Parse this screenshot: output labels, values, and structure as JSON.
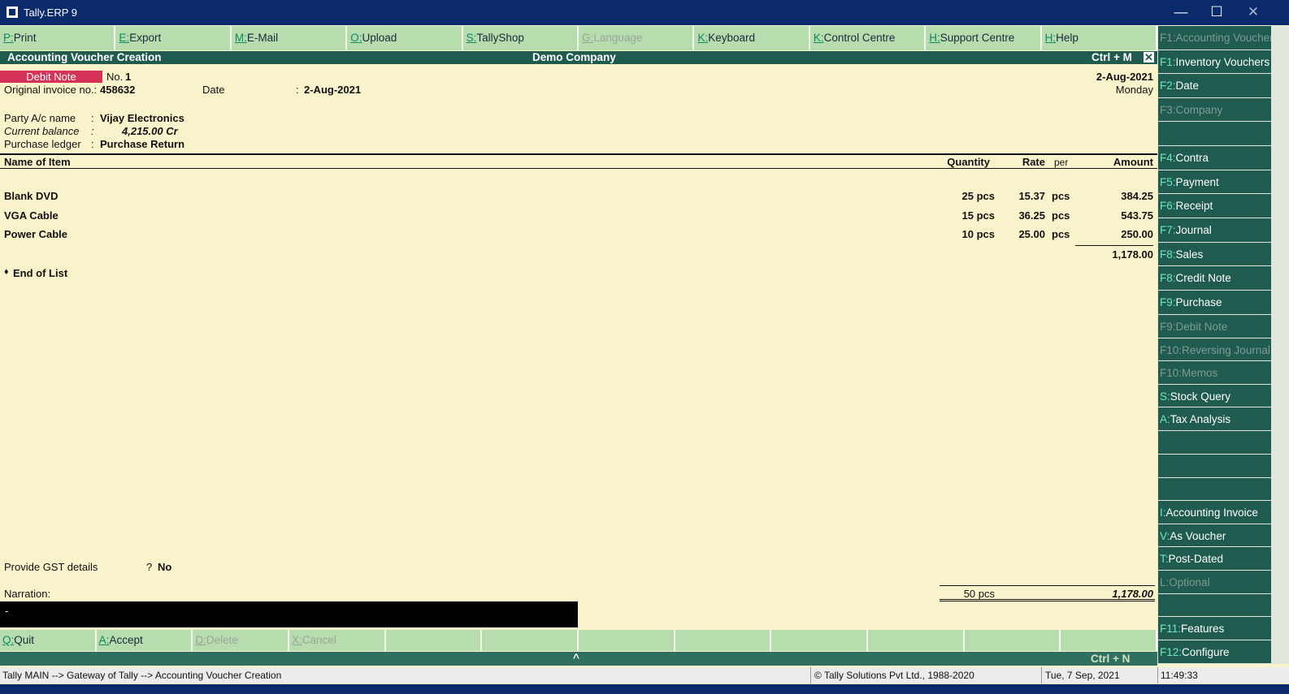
{
  "window": {
    "title": "Tally.ERP 9",
    "minimize": "—",
    "maximize": "☐",
    "close": "✕"
  },
  "toolbar": [
    {
      "key": "P",
      "label": "Print",
      "enabled": true
    },
    {
      "key": "E",
      "label": "Export",
      "enabled": true
    },
    {
      "key": "M",
      "label": "E-Mail",
      "enabled": true
    },
    {
      "key": "O",
      "label": "Upload",
      "enabled": true
    },
    {
      "key": "S",
      "label": "TallyShop",
      "enabled": true
    },
    {
      "key": "G",
      "label": "Language",
      "enabled": false
    },
    {
      "key": "K",
      "label": "Keyboard",
      "enabled": true
    },
    {
      "key": "K",
      "label": "Control Centre",
      "enabled": true
    },
    {
      "key": "H",
      "label": "Support Centre",
      "enabled": true
    },
    {
      "key": "H",
      "label": "Help",
      "enabled": true
    }
  ],
  "header": {
    "title": "Accounting Voucher  Creation",
    "company": "Demo Company",
    "shortcut": "Ctrl + M",
    "close": "✕"
  },
  "voucher": {
    "type": "Debit Note",
    "no_label": "No.",
    "no_value": "1",
    "orig_inv_label": "Original invoice no.:",
    "orig_inv_value": "458632",
    "date_label": "Date",
    "date_colon": ":",
    "date_value": "2-Aug-2021",
    "top_date": "2-Aug-2021",
    "top_day": "Monday",
    "party_label": "Party A/c name",
    "party_value": "Vijay Electronics",
    "balance_label": "Current balance",
    "balance_value": "4,215.00 Cr",
    "ledger_label": "Purchase ledger",
    "ledger_value": "Purchase Return",
    "colon": ":"
  },
  "table": {
    "headers": {
      "name": "Name of Item",
      "quantity": "Quantity",
      "rate": "Rate",
      "per": "per",
      "amount": "Amount"
    },
    "rows": [
      {
        "name": "Blank DVD",
        "quantity": "25 pcs",
        "rate": "15.37",
        "per": "pcs",
        "amount": "384.25"
      },
      {
        "name": "VGA Cable",
        "quantity": "15 pcs",
        "rate": "36.25",
        "per": "pcs",
        "amount": "543.75"
      },
      {
        "name": "Power Cable",
        "quantity": "10 pcs",
        "rate": "25.00",
        "per": "pcs",
        "amount": "250.00"
      }
    ],
    "subtotal": "1,178.00",
    "end_of_list": "End of List",
    "end_marker": "♦"
  },
  "gst": {
    "label": "Provide GST details",
    "q": "?",
    "value": "No"
  },
  "narration": {
    "label": "Narration:",
    "value": "-"
  },
  "totals": {
    "quantity": "50 pcs",
    "amount": "1,178.00"
  },
  "bottom_buttons": [
    {
      "key": "Q",
      "label": "Quit",
      "enabled": true
    },
    {
      "key": "A",
      "label": "Accept",
      "enabled": true
    },
    {
      "key": "D",
      "label": "Delete",
      "enabled": false
    },
    {
      "key": "X",
      "label": "Cancel",
      "enabled": false
    },
    {
      "key": "",
      "label": "",
      "enabled": false
    },
    {
      "key": "",
      "label": "",
      "enabled": false
    },
    {
      "key": "",
      "label": "",
      "enabled": false
    },
    {
      "key": "",
      "label": "",
      "enabled": false
    },
    {
      "key": "",
      "label": "",
      "enabled": false
    },
    {
      "key": "",
      "label": "",
      "enabled": false
    },
    {
      "key": "",
      "label": "",
      "enabled": false
    },
    {
      "key": "",
      "label": "",
      "enabled": false
    }
  ],
  "strip": {
    "caret": "^",
    "shortcut": "Ctrl + N"
  },
  "sidebar": [
    {
      "key": "F1",
      "label": "Accounting Vouchers",
      "enabled": false
    },
    {
      "key": "F1",
      "label": "Inventory Vouchers",
      "enabled": true
    },
    {
      "key": "F2",
      "label": "Date",
      "enabled": true
    },
    {
      "key": "F3",
      "label": "Company",
      "enabled": false
    },
    {
      "key": "",
      "label": "",
      "enabled": false
    },
    {
      "key": "F4",
      "label": "Contra",
      "enabled": true
    },
    {
      "key": "F5",
      "label": "Payment",
      "enabled": true
    },
    {
      "key": "F6",
      "label": "Receipt",
      "enabled": true
    },
    {
      "key": "F7",
      "label": "Journal",
      "enabled": true
    },
    {
      "key": "F8",
      "label": "Sales",
      "enabled": true
    },
    {
      "key": "F8",
      "label": "Credit Note",
      "enabled": true
    },
    {
      "key": "F9",
      "label": "Purchase",
      "enabled": true
    },
    {
      "key": "F9",
      "label": "Debit Note",
      "enabled": false
    },
    {
      "key": "F10",
      "label": "Reversing Journal",
      "enabled": false
    },
    {
      "key": "F10",
      "label": "Memos",
      "enabled": false
    },
    {
      "key": "S",
      "label": "Stock Query",
      "enabled": true
    },
    {
      "key": "A",
      "label": "Tax Analysis",
      "enabled": true
    },
    {
      "key": "",
      "label": "",
      "enabled": false
    },
    {
      "key": "",
      "label": "",
      "enabled": false
    },
    {
      "key": "",
      "label": "",
      "enabled": false
    },
    {
      "key": "I",
      "label": "Accounting Invoice",
      "enabled": true
    },
    {
      "key": "V",
      "label": "As Voucher",
      "enabled": true
    },
    {
      "key": "T",
      "label": "Post-Dated",
      "enabled": true
    },
    {
      "key": "L",
      "label": "Optional",
      "enabled": false
    },
    {
      "key": "",
      "label": "",
      "enabled": false
    },
    {
      "key": "F11",
      "label": "Features",
      "enabled": true
    },
    {
      "key": "F12",
      "label": "Configure",
      "enabled": true
    }
  ],
  "status": {
    "path": "Tally MAIN --> Gateway of Tally --> Accounting Voucher  Creation",
    "copyright": "© Tally Solutions Pvt Ltd., 1988-2020",
    "date": "Tue, 7 Sep, 2021",
    "time": "11:49:33"
  }
}
